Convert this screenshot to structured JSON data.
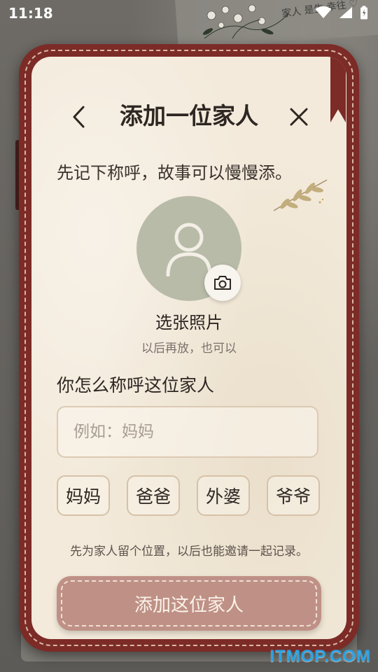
{
  "status_bar": {
    "time": "11:18"
  },
  "background": {
    "handwriting": "家人 是生 幸往 ♡"
  },
  "dialog": {
    "title": "添加一位家人",
    "subtitle": "先记下称呼，故事可以慢慢添。",
    "photo": {
      "label": "选张照片",
      "hint": "以后再放，也可以"
    },
    "name_field": {
      "label": "你怎么称呼这位家人",
      "placeholder": "例如：妈妈",
      "value": ""
    },
    "chips": [
      "妈妈",
      "爸爸",
      "外婆",
      "爷爷"
    ],
    "note": "先为家人留个位置，以后也能邀请一起记录。",
    "submit_label": "添加这位家人"
  },
  "watermark": "ITMOP.COM",
  "colors": {
    "frame": "#7c2b27",
    "paper": "#f3eadb",
    "avatar": "#b9bba9",
    "submit": "#bf9186"
  }
}
